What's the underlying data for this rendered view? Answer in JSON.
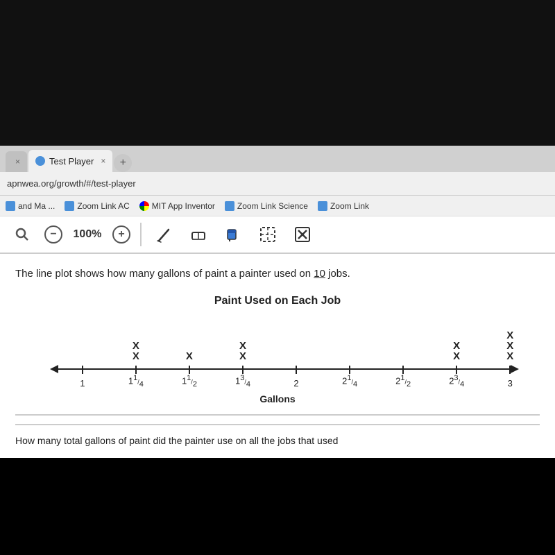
{
  "browser": {
    "black_top_height": 210,
    "tabs": [
      {
        "id": "inactive",
        "label": "",
        "close": "×"
      },
      {
        "id": "active",
        "label": "Test Player",
        "close": "×"
      },
      {
        "id": "new",
        "label": "+"
      }
    ],
    "address": "apnwea.org/growth/#/test-player",
    "bookmarks": [
      {
        "id": "and-ma",
        "label": "and Ma ...",
        "icon": "person"
      },
      {
        "id": "zoom-ac",
        "label": "Zoom Link AC",
        "icon": "person"
      },
      {
        "id": "mit",
        "label": "MIT App Inventor",
        "icon": "colorful"
      },
      {
        "id": "zoom-sci",
        "label": "Zoom Link Science",
        "icon": "person"
      },
      {
        "id": "zoom-link",
        "label": "Zoom Link",
        "icon": "person"
      }
    ]
  },
  "toolbar": {
    "zoom_minus": "−",
    "zoom_value": "100%",
    "zoom_plus": "+",
    "tools": [
      "pen",
      "eraser",
      "bucket",
      "select",
      "close"
    ]
  },
  "content": {
    "question_text": "The line plot shows how many gallons of paint a painter used on 10 jobs.",
    "chart_title": "Paint Used on Each Job",
    "gallons_label": "Gallons",
    "bottom_question": "How many total gallons of paint did the painter use on all the jobs that used"
  },
  "line_plot": {
    "ticks": [
      {
        "id": "t1",
        "label": "1",
        "left_pct": 5.5
      },
      {
        "id": "t114",
        "label": "1¼",
        "left_pct": 17
      },
      {
        "id": "t112",
        "label": "1½",
        "left_pct": 28.5
      },
      {
        "id": "t134",
        "label": "1¾",
        "left_pct": 40
      },
      {
        "id": "t2",
        "label": "2",
        "left_pct": 51.5
      },
      {
        "id": "t214",
        "label": "2¼",
        "left_pct": 63
      },
      {
        "id": "t212",
        "label": "2½",
        "left_pct": 74.5
      },
      {
        "id": "t234",
        "label": "2¾",
        "left_pct": 86
      },
      {
        "id": "t3",
        "label": "3",
        "left_pct": 97.5
      }
    ],
    "x_marks": [
      {
        "id": "x1",
        "tick": "t114",
        "row": 2
      },
      {
        "id": "x2",
        "tick": "t114",
        "row": 1
      },
      {
        "id": "x3",
        "tick": "t112",
        "row": 1
      },
      {
        "id": "x4",
        "tick": "t134",
        "row": 2
      },
      {
        "id": "x5",
        "tick": "t134",
        "row": 1
      },
      {
        "id": "x6",
        "tick": "t234",
        "row": 1
      },
      {
        "id": "x7",
        "tick": "t234",
        "row": 2
      },
      {
        "id": "x8",
        "tick": "t3",
        "row": 3
      },
      {
        "id": "x9",
        "tick": "t3",
        "row": 2
      },
      {
        "id": "x10",
        "tick": "t3",
        "row": 1
      }
    ]
  }
}
